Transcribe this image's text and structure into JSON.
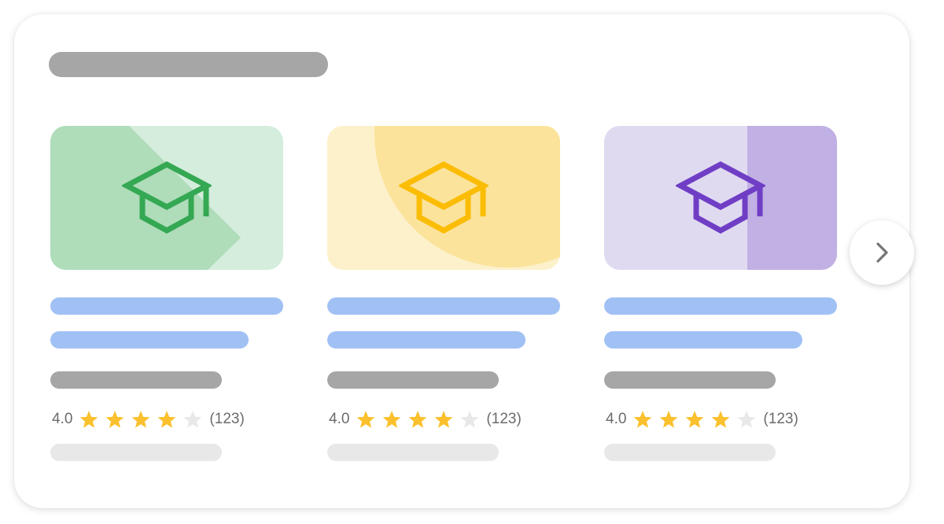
{
  "cards": [
    {
      "rating": "4.0",
      "review_count": "(123)",
      "stars_filled": 4,
      "stars_total": 5,
      "icon": "graduation-cap-icon",
      "colors": {
        "light": "#d4eddc",
        "mid": "#afdcb9",
        "accent": "#34a853"
      }
    },
    {
      "rating": "4.0",
      "review_count": "(123)",
      "stars_filled": 4,
      "stars_total": 5,
      "icon": "graduation-cap-icon",
      "colors": {
        "light": "#fdf1cc",
        "mid": "#fbe39b",
        "accent": "#fbbc04"
      }
    },
    {
      "rating": "4.0",
      "review_count": "(123)",
      "stars_filled": 4,
      "stars_total": 5,
      "icon": "graduation-cap-icon",
      "colors": {
        "light": "#e0daf1",
        "mid": "#c1b0e3",
        "accent": "#6f3ec5"
      }
    }
  ],
  "next_button": {
    "icon": "chevron-right-icon"
  },
  "colors": {
    "star_filled": "#fbc02d",
    "star_empty": "#e8e8e8",
    "text_bar": "#a6a6a6",
    "link_bar": "#a1c1f5",
    "faint_bar": "#e8e8e8"
  }
}
